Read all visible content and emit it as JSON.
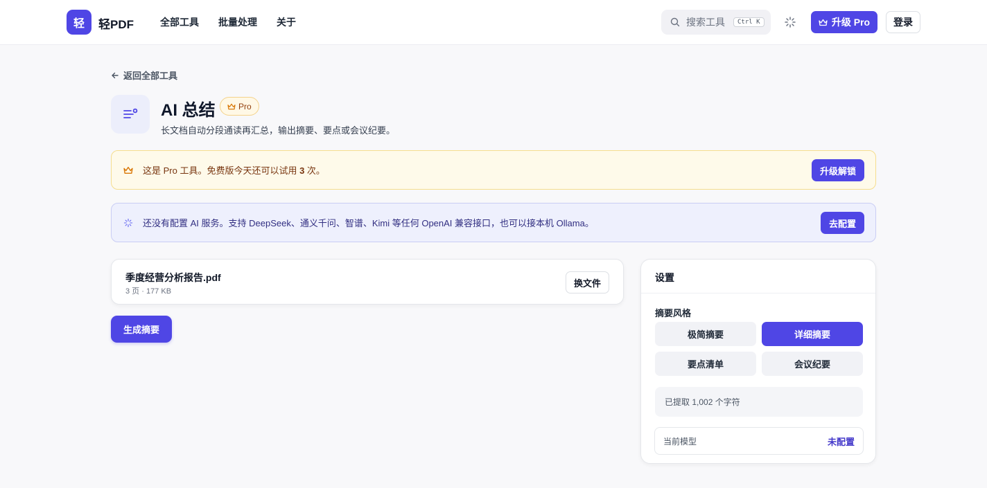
{
  "header": {
    "logo_char": "轻",
    "brand": "轻PDF",
    "nav": [
      "全部工具",
      "批量处理",
      "关于"
    ],
    "search_placeholder": "搜索工具",
    "search_shortcut": "Ctrl K",
    "upgrade_label": "升级 Pro",
    "login_label": "登录"
  },
  "back_link": "返回全部工具",
  "tool": {
    "title": "AI 总结",
    "badge": "Pro",
    "subtitle": "长文档自动分段通读再汇总，输出摘要、要点或会议纪要。"
  },
  "notice_pro": {
    "text_before": "这是 Pro 工具。免费版今天还可以试用 ",
    "count": "3",
    "text_after": " 次。",
    "button": "升级解锁"
  },
  "notice_ai": {
    "text": "还没有配置 AI 服务。支持 DeepSeek、通义千问、智谱、Kimi 等任何 OpenAI 兼容接口，也可以接本机 Ollama。",
    "button": "去配置"
  },
  "file": {
    "name": "季度经营分析报告.pdf",
    "meta": "3 页 · 177 KB",
    "change_button": "换文件"
  },
  "generate_button": "生成摘要",
  "settings": {
    "title": "设置",
    "style_label": "摘要风格",
    "options": [
      "极简摘要",
      "详细摘要",
      "要点清单",
      "会议纪要"
    ],
    "selected": "详细摘要",
    "extracted": "已提取 1,002 个字符",
    "model_label": "当前模型",
    "model_value": "未配置"
  },
  "colors": {
    "accent": "#4f46e5",
    "pro_notice_bg": "#fefaea",
    "ai_notice_bg": "#eef0fd"
  }
}
